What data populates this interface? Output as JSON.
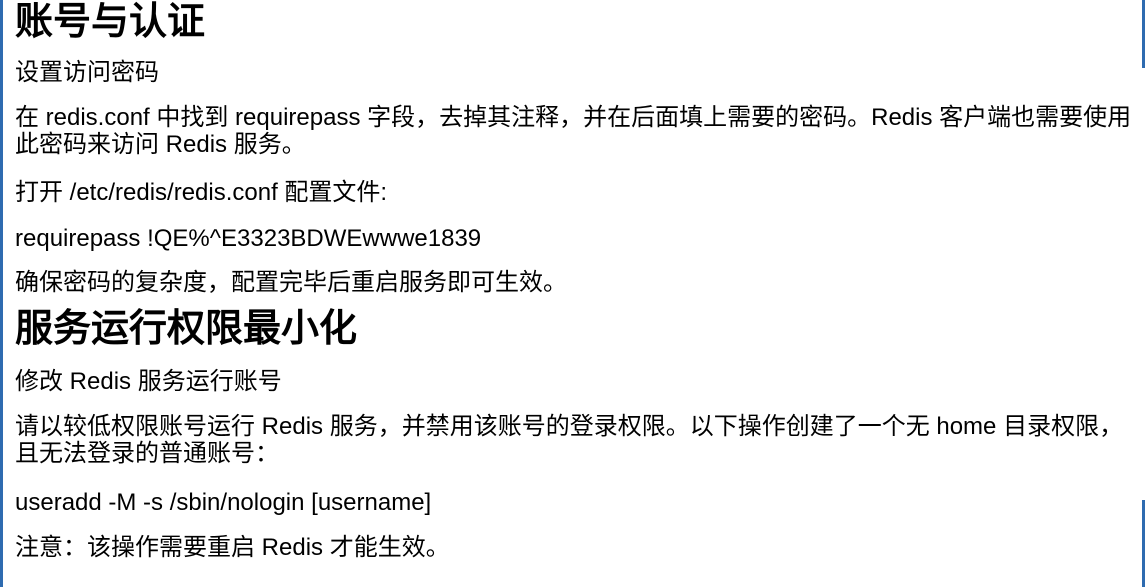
{
  "section1": {
    "title": "账号与认证",
    "subtitle": "设置访问密码",
    "paragraph": "在 redis.conf 中找到 requirepass 字段，去掉其注释，并在后面填上需要的密码。Redis 客户端也需要使用此密码来访问 Redis 服务。",
    "open_file_text": "打开 /etc/redis/redis.conf 配置文件:",
    "code_line": "requirepass !QE%^E3323BDWEwwwe1839",
    "note": "确保密码的复杂度，配置完毕后重启服务即可生效。"
  },
  "section2": {
    "title": "服务运行权限最小化",
    "subtitle": "修改 Redis 服务运行账号",
    "paragraph": "请以较低权限账号运行 Redis 服务，并禁用该账号的登录权限。以下操作创建了一个无 home 目录权限，且无法登录的普通账号：",
    "code_line": "useradd -M -s /sbin/nologin [username]",
    "note": "注意：该操作需要重启 Redis 才能生效。"
  },
  "colors": {
    "accent": "#2e6bb0",
    "text": "#000000",
    "background": "#ffffff"
  }
}
